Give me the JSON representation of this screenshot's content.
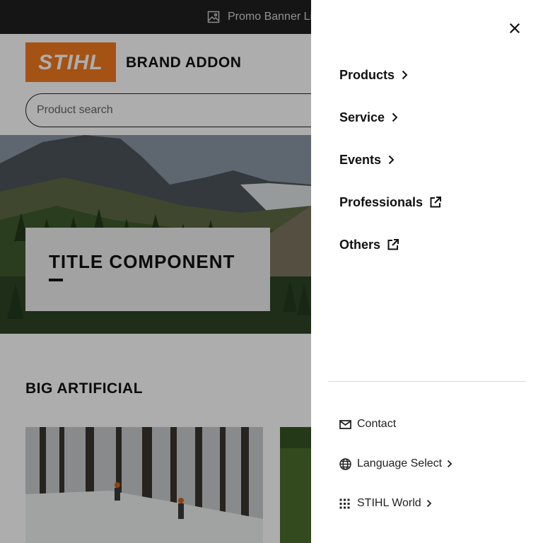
{
  "promo_banner": {
    "label": "Promo Banner Link",
    "icon": "image-icon"
  },
  "header": {
    "logo_text": "STIHL",
    "brand_addon": "BRAND ADDON",
    "search_placeholder": "Product search"
  },
  "hero": {
    "title": "TITLE COMPONENT"
  },
  "section": {
    "title": "BIG ARTIFICIAL"
  },
  "menu": {
    "items": [
      {
        "label": "Products",
        "icon": "chevron-right-icon"
      },
      {
        "label": "Service",
        "icon": "chevron-right-icon"
      },
      {
        "label": "Events",
        "icon": "chevron-right-icon"
      },
      {
        "label": "Professionals",
        "icon": "external-link-icon"
      },
      {
        "label": "Others",
        "icon": "external-link-icon"
      }
    ],
    "utility": [
      {
        "label": "Contact",
        "icon": "mail-icon"
      },
      {
        "label": "Language Select",
        "icon": "globe-icon"
      },
      {
        "label": "STIHL World",
        "icon": "grid-icon"
      }
    ],
    "close_icon": "close-icon"
  },
  "colors": {
    "brand_orange": "#f37a1f",
    "promo_bg": "#1f1f1f",
    "text": "#111111",
    "overlay": "rgba(0,0,0,0.32)"
  }
}
